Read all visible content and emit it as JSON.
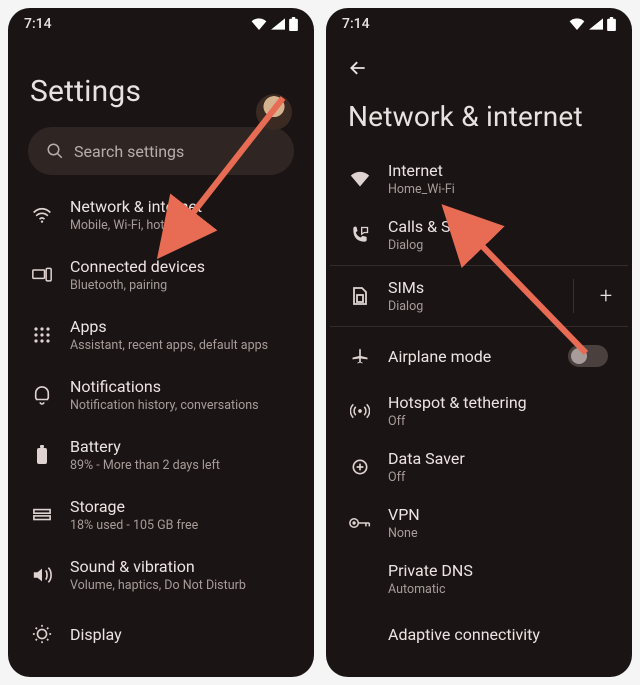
{
  "status": {
    "time": "7:14",
    "icons": [
      "wifi",
      "signal",
      "battery"
    ]
  },
  "p1": {
    "heading": "Settings",
    "search_placeholder": "Search settings",
    "items": [
      {
        "icon": "wifi",
        "title": "Network & internet",
        "sub": "Mobile, Wi-Fi, hotspot"
      },
      {
        "icon": "devices",
        "title": "Connected devices",
        "sub": "Bluetooth, pairing"
      },
      {
        "icon": "apps",
        "title": "Apps",
        "sub": "Assistant, recent apps, default apps"
      },
      {
        "icon": "bell",
        "title": "Notifications",
        "sub": "Notification history, conversations"
      },
      {
        "icon": "battery",
        "title": "Battery",
        "sub": "89% - More than 2 days left"
      },
      {
        "icon": "storage",
        "title": "Storage",
        "sub": "18% used - 105 GB free"
      },
      {
        "icon": "volume",
        "title": "Sound & vibration",
        "sub": "Volume, haptics, Do Not Disturb"
      },
      {
        "icon": "display",
        "title": "Display",
        "sub": ""
      }
    ]
  },
  "p2": {
    "heading": "Network & internet",
    "items": [
      {
        "icon": "wifi-fill",
        "title": "Internet",
        "sub": "Home_Wi-Fi"
      },
      {
        "icon": "calls",
        "title": "Calls & SMS",
        "sub": "Dialog"
      },
      {
        "icon": "sim",
        "title": "SIMs",
        "sub": "Dialog",
        "trail": "plus"
      },
      {
        "icon": "airplane",
        "title": "Airplane mode",
        "sub": "",
        "trail": "switch"
      },
      {
        "icon": "hotspot",
        "title": "Hotspot & tethering",
        "sub": "Off"
      },
      {
        "icon": "datasaver",
        "title": "Data Saver",
        "sub": "Off"
      },
      {
        "icon": "vpn",
        "title": "VPN",
        "sub": "None"
      },
      {
        "icon": "",
        "title": "Private DNS",
        "sub": "Automatic"
      },
      {
        "icon": "",
        "title": "Adaptive connectivity",
        "sub": ""
      }
    ]
  },
  "arrow_color": "#e86b53"
}
